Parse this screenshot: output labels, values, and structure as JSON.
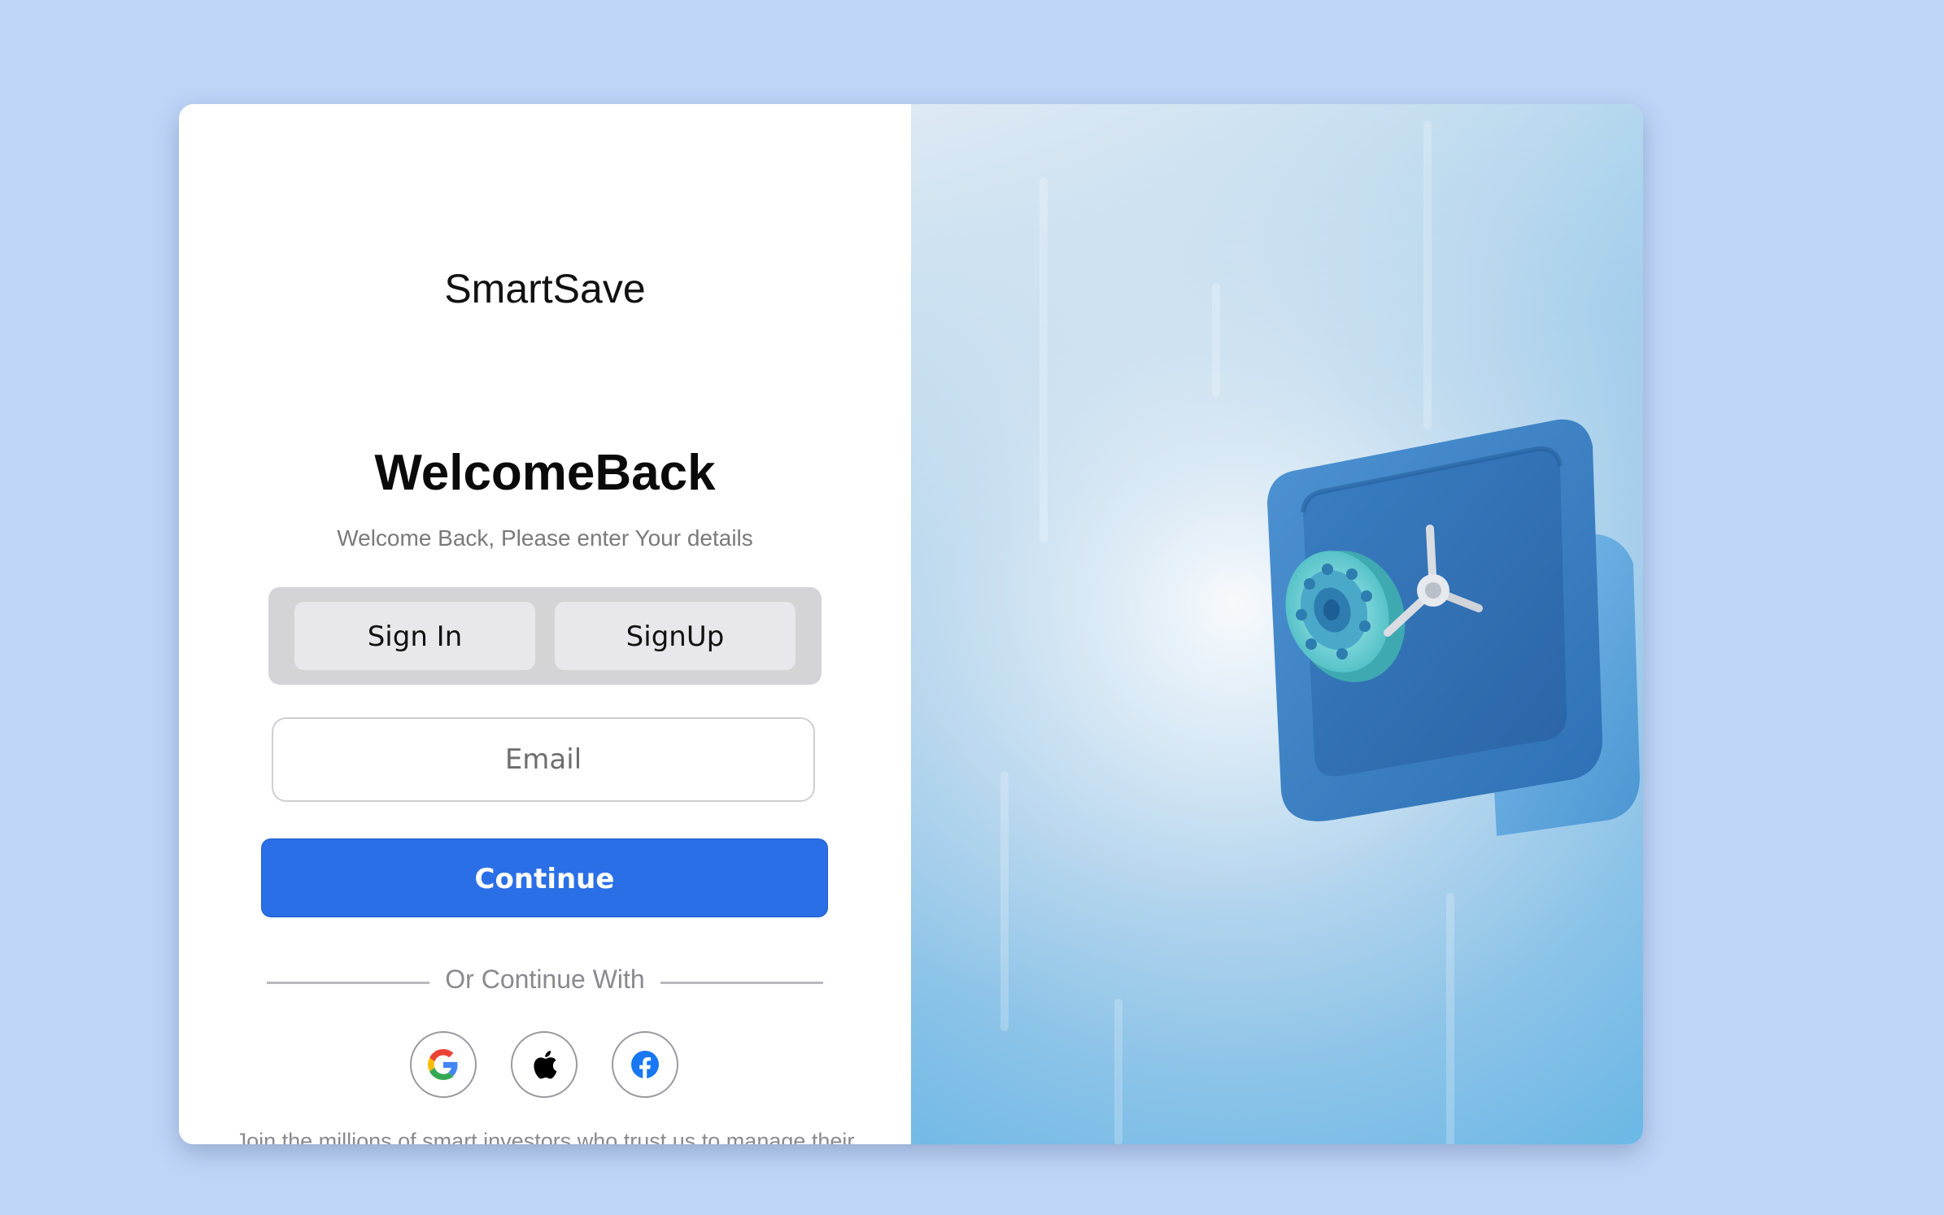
{
  "brand": {
    "name": "SmartSave"
  },
  "header": {
    "title": "WelcomeBack",
    "subtitle": "Welcome Back, Please enter Your details"
  },
  "auth_tabs": {
    "sign_in_label": "Sign In",
    "sign_up_label": "SignUp"
  },
  "form": {
    "email_placeholder": "Email",
    "email_value": "",
    "continue_label": "Continue"
  },
  "social": {
    "divider_text": "Or Continue With",
    "providers": [
      {
        "name": "Google",
        "icon": "google-icon"
      },
      {
        "name": "Apple",
        "icon": "apple-icon"
      },
      {
        "name": "Facebook",
        "icon": "facebook-icon"
      }
    ]
  },
  "footer": {
    "text": "Join the millions of smart investors who trust us to manage their finances. Log in to access your personalized dashboard, track your portfolio perfomances, and make informed investment desicions."
  },
  "hero": {
    "icon": "safe-icon"
  },
  "colors": {
    "page_background": "#bed5f8",
    "primary_button": "#2a6fe6",
    "tab_track": "#d4d4d6",
    "tab_button": "#e8e8ec",
    "safe_blue": "#4a8ccc",
    "dial_teal": "#6fd0d0"
  }
}
